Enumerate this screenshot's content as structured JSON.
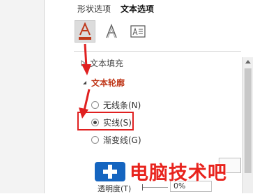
{
  "tabs": [
    {
      "label": "形状选项",
      "active": false
    },
    {
      "label": "文本选项",
      "active": true
    }
  ],
  "icons": [
    "text-fill-outline-icon",
    "text-effects-icon",
    "text-box-icon"
  ],
  "sections": {
    "fill_label": "文本填充",
    "line_label": "文本轮廓"
  },
  "options": [
    {
      "label": "无线条(N)",
      "checked": false
    },
    {
      "label": "实线(S)",
      "checked": true
    },
    {
      "label": "渐变线(G)",
      "checked": false
    }
  ],
  "transparency": {
    "label": "透明度(T)",
    "value": "0%"
  },
  "watermark": {
    "text": "电脑技术吧"
  },
  "colors": {
    "accent": "#c0391b",
    "annotation": "#e02020",
    "watermark": "#e8231d",
    "swatch": "#1565c0"
  }
}
